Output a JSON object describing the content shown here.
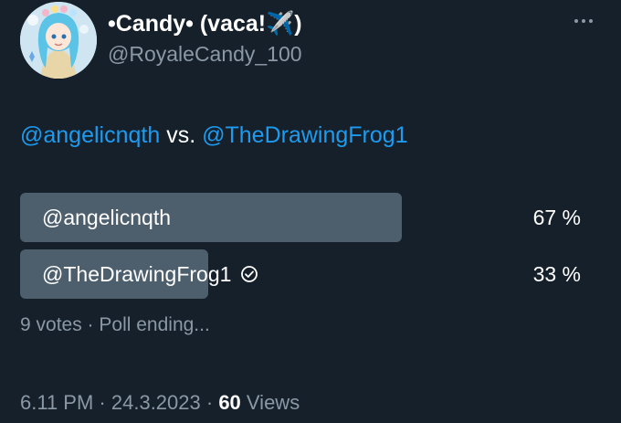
{
  "user": {
    "display_name": "•Candy• (vaca!✈️)",
    "handle": "@RoyaleCandy_100"
  },
  "tweet": {
    "mention_1": "@angelicnqth",
    "vs_text": " vs. ",
    "mention_2": "@TheDrawingFrog1"
  },
  "poll": {
    "options": [
      {
        "label": "@angelicnqth",
        "percent_text": "67 %",
        "fraction": 0.67,
        "winner": true
      },
      {
        "label": "@TheDrawingFrog1",
        "percent_text": "33 %",
        "fraction": 0.33,
        "selected": true
      }
    ],
    "votes": "9 votes",
    "separator": " · ",
    "status": "Poll ending..."
  },
  "footer": {
    "time": "6.11 PM",
    "separator": " · ",
    "date": "24.3.2023",
    "views_count": "60",
    "views_label": " Views"
  },
  "colors": {
    "background": "#15202b",
    "accent": "#1d9bf0",
    "muted": "#8b98a5",
    "poll_bar": "#4d5e6c"
  },
  "icons": {
    "more": "more-horizontal-icon",
    "selected_choice": "check-circle-icon"
  }
}
